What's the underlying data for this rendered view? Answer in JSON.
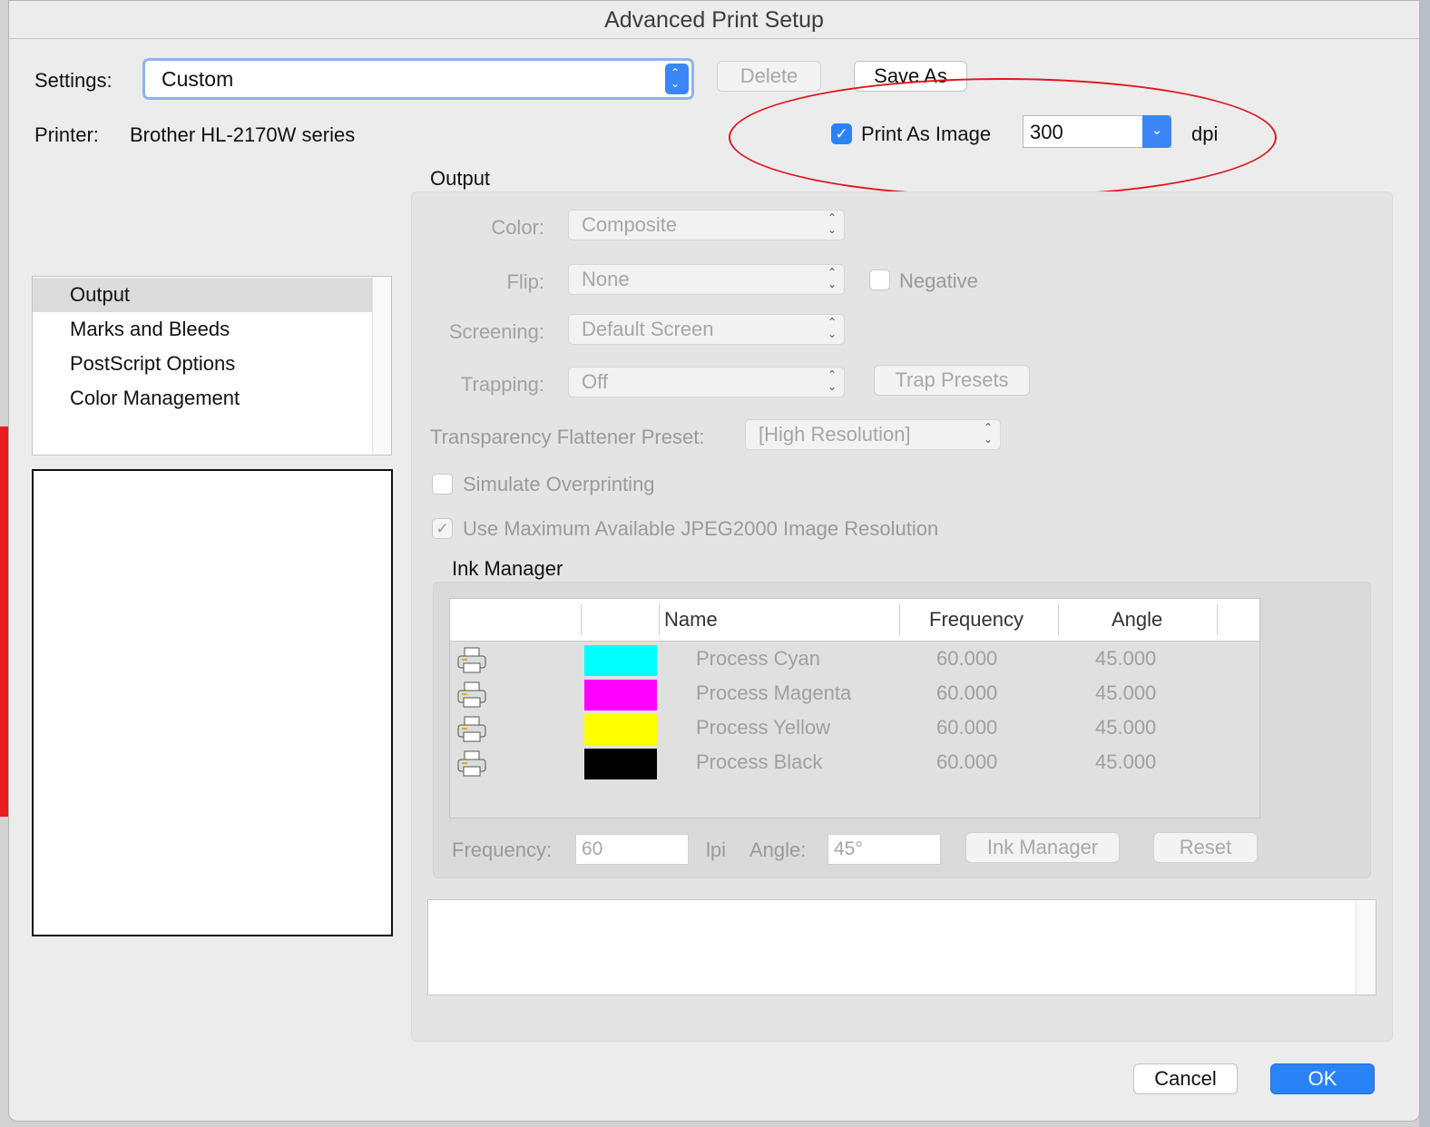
{
  "window": {
    "title": "Advanced Print Setup"
  },
  "settings": {
    "label": "Settings:",
    "value": "Custom",
    "delete_label": "Delete",
    "save_as_label": "Save As"
  },
  "printer": {
    "label": "Printer:",
    "value": "Brother HL-2170W series"
  },
  "print_as_image": {
    "label": "Print As Image",
    "checked": true,
    "dpi_value": "300",
    "dpi_unit": "dpi"
  },
  "categories": {
    "items": [
      {
        "label": "Output",
        "selected": true
      },
      {
        "label": "Marks and Bleeds",
        "selected": false
      },
      {
        "label": "PostScript Options",
        "selected": false
      },
      {
        "label": "Color Management",
        "selected": false
      }
    ]
  },
  "output": {
    "heading": "Output",
    "color": {
      "label": "Color:",
      "value": "Composite"
    },
    "flip": {
      "label": "Flip:",
      "value": "None"
    },
    "negative": {
      "label": "Negative",
      "checked": false
    },
    "screening": {
      "label": "Screening:",
      "value": "Default Screen"
    },
    "trapping": {
      "label": "Trapping:",
      "value": "Off"
    },
    "trap_presets_label": "Trap Presets",
    "flattener": {
      "label": "Transparency Flattener Preset:",
      "value": "[High Resolution]"
    },
    "simulate_overprinting": {
      "label": "Simulate Overprinting",
      "checked": false
    },
    "jpeg2000": {
      "label": "Use Maximum Available JPEG2000 Image Resolution",
      "checked": true
    }
  },
  "ink_manager": {
    "heading": "Ink Manager",
    "columns": [
      "",
      "",
      "Name",
      "Frequency",
      "Angle"
    ],
    "rows": [
      {
        "name": "Process Cyan",
        "color": "#00ffff",
        "frequency": "60.000",
        "angle": "45.000"
      },
      {
        "name": "Process Magenta",
        "color": "#ff00ff",
        "frequency": "60.000",
        "angle": "45.000"
      },
      {
        "name": "Process Yellow",
        "color": "#ffff00",
        "frequency": "60.000",
        "angle": "45.000"
      },
      {
        "name": "Process Black",
        "color": "#000000",
        "frequency": "60.000",
        "angle": "45.000"
      }
    ],
    "frequency_label": "Frequency:",
    "frequency_value": "60",
    "lpi_label": "lpi",
    "angle_label": "Angle:",
    "angle_value": "45°",
    "ink_manager_button": "Ink Manager",
    "reset_button": "Reset"
  },
  "footer": {
    "cancel_label": "Cancel",
    "ok_label": "OK"
  },
  "icons": {
    "printer": "printer-icon",
    "check": "checkmark-icon",
    "stepper": "updown-chevron-icon",
    "dropdown": "chevron-down-icon"
  },
  "colors": {
    "accent": "#2a83f6",
    "annotation": "#e0151c"
  }
}
